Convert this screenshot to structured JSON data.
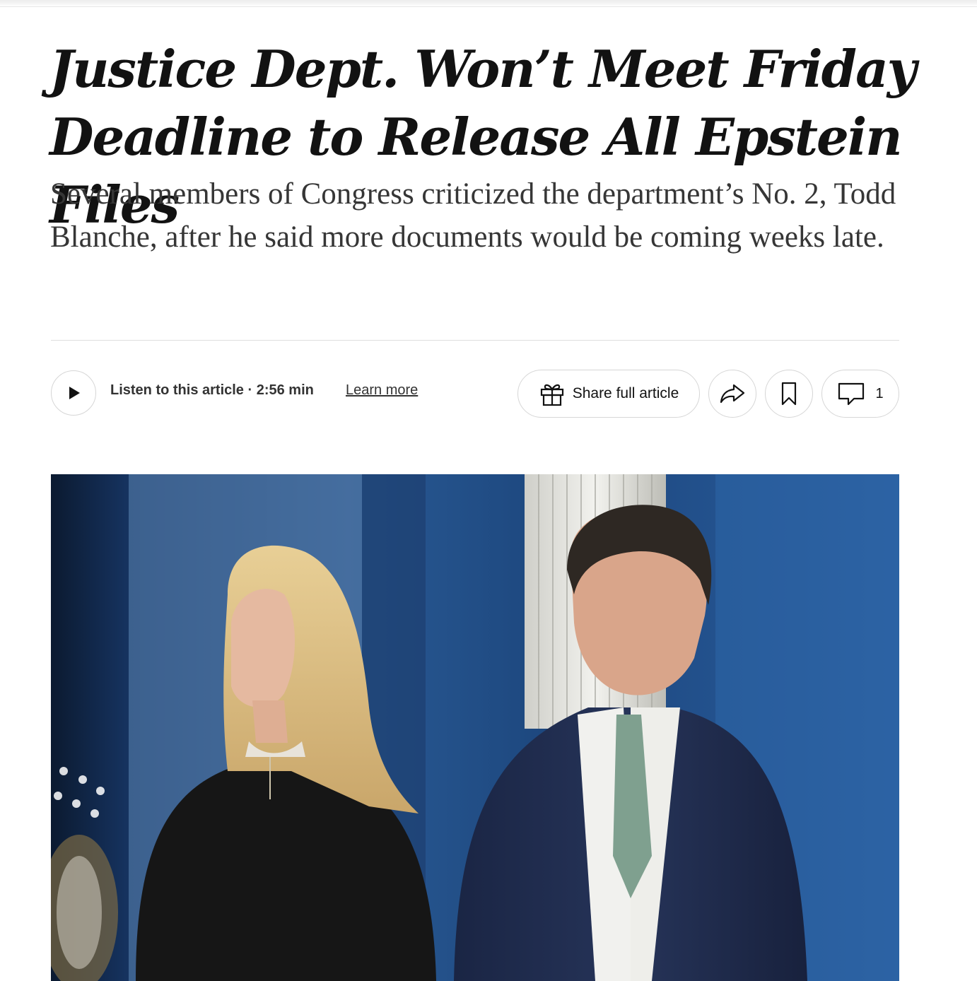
{
  "article": {
    "headline": "Justice Dept. Won’t Meet Friday Deadline to Release All Epstein Files",
    "summary": "Several members of Congress criticized the department’s No. 2, Todd Blanche, after he said more documents would be coming weeks late."
  },
  "toolbar": {
    "listen_label": "Listen to this article · 2:56 min",
    "learn_more_label": "Learn more",
    "share_full_label": "Share full article",
    "comment_count": "1",
    "icons": {
      "play": "play-icon",
      "gift": "gift-icon",
      "share": "share-arrow-icon",
      "save": "bookmark-icon",
      "comments": "comment-icon"
    }
  },
  "colors": {
    "text": "#121212",
    "summary_text": "#363636",
    "border": "#d6d6d6",
    "photo_background": "#1b3c6e"
  }
}
